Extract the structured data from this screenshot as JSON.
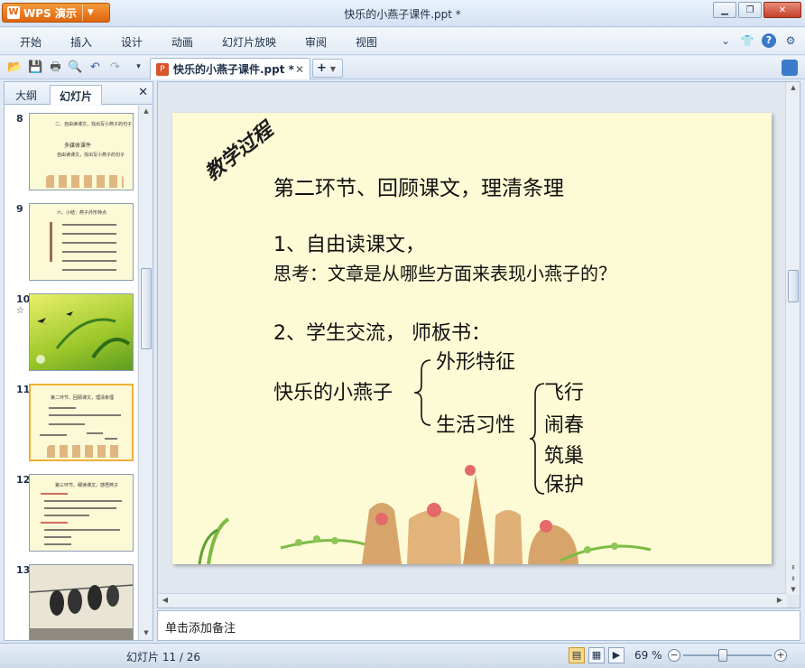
{
  "app": {
    "name": "WPS 演示",
    "window_title": "快乐的小燕子课件.ppt *"
  },
  "menu": [
    "开始",
    "插入",
    "设计",
    "动画",
    "幻灯片放映",
    "审阅",
    "视图"
  ],
  "doc_tab": {
    "name": "快乐的小燕子课件.ppt *"
  },
  "panel": {
    "tabs": [
      "大纲",
      "幻灯片"
    ],
    "active_tab": "幻灯片"
  },
  "thumbnails": [
    {
      "num": "8",
      "lines": [
        "二、自由读课文，找出写小燕子的句子",
        "多媒体课件",
        "自由读课文，找出写小燕子的句子"
      ]
    },
    {
      "num": "9",
      "lines": [
        "六、小结：燕子外形特点"
      ]
    },
    {
      "num": "10",
      "star": "☆",
      "lines": []
    },
    {
      "num": "11",
      "lines": [
        "第二环节、回顾课文，理清条理"
      ],
      "selected": true
    },
    {
      "num": "12",
      "lines": [
        "第三环节、细读课文，感悟燕子"
      ]
    },
    {
      "num": "13",
      "lines": []
    }
  ],
  "slide": {
    "tag": "教学过程",
    "heading": "第二环节、回顾课文，理清条理",
    "item1": "1、自由读课文，",
    "question": "思考：文章是从哪些方面来表现小燕子的？",
    "item2": "2、学生交流， 师板书：",
    "root": "快乐的小燕子",
    "branch1": "外形特征",
    "branch2": "生活习性",
    "leaves": [
      "飞行",
      "闹春",
      "筑巢",
      "保护"
    ]
  },
  "notes": {
    "placeholder": "单击添加备注"
  },
  "status": {
    "slide_counter": "幻灯片 11 / 26",
    "zoom": "69 %",
    "zoom_level": 0.69
  },
  "colors": {
    "accent": "#e0650d",
    "slide_bg": "#fdfbd5",
    "selection": "#f0b036"
  }
}
